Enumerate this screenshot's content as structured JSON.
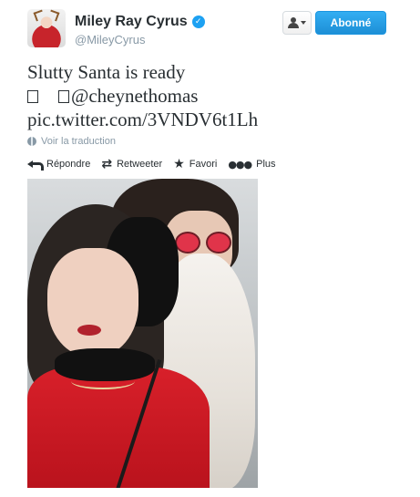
{
  "user": {
    "name": "Miley Ray Cyrus",
    "screen_name": "@MileyCyrus",
    "verified_glyph": "✓"
  },
  "buttons": {
    "follow_label": "Abonné"
  },
  "tweet": {
    "line1": "Slutty Santa is ready",
    "line2_mention": "@cheynethomas",
    "line3_link": "pic.twitter.com/3VNDV6t1Lh"
  },
  "translate_label": "Voir la traduction",
  "actions": {
    "reply": "Répondre",
    "retweet": "Retweeter",
    "favorite": "Favori",
    "more": "Plus"
  },
  "icons": {
    "retweet_glyph": "⇄",
    "star_glyph": "★",
    "more_glyph": "●●●"
  },
  "colors": {
    "accent": "#1da1f2",
    "text": "#292f33",
    "muted": "#8899a6"
  }
}
